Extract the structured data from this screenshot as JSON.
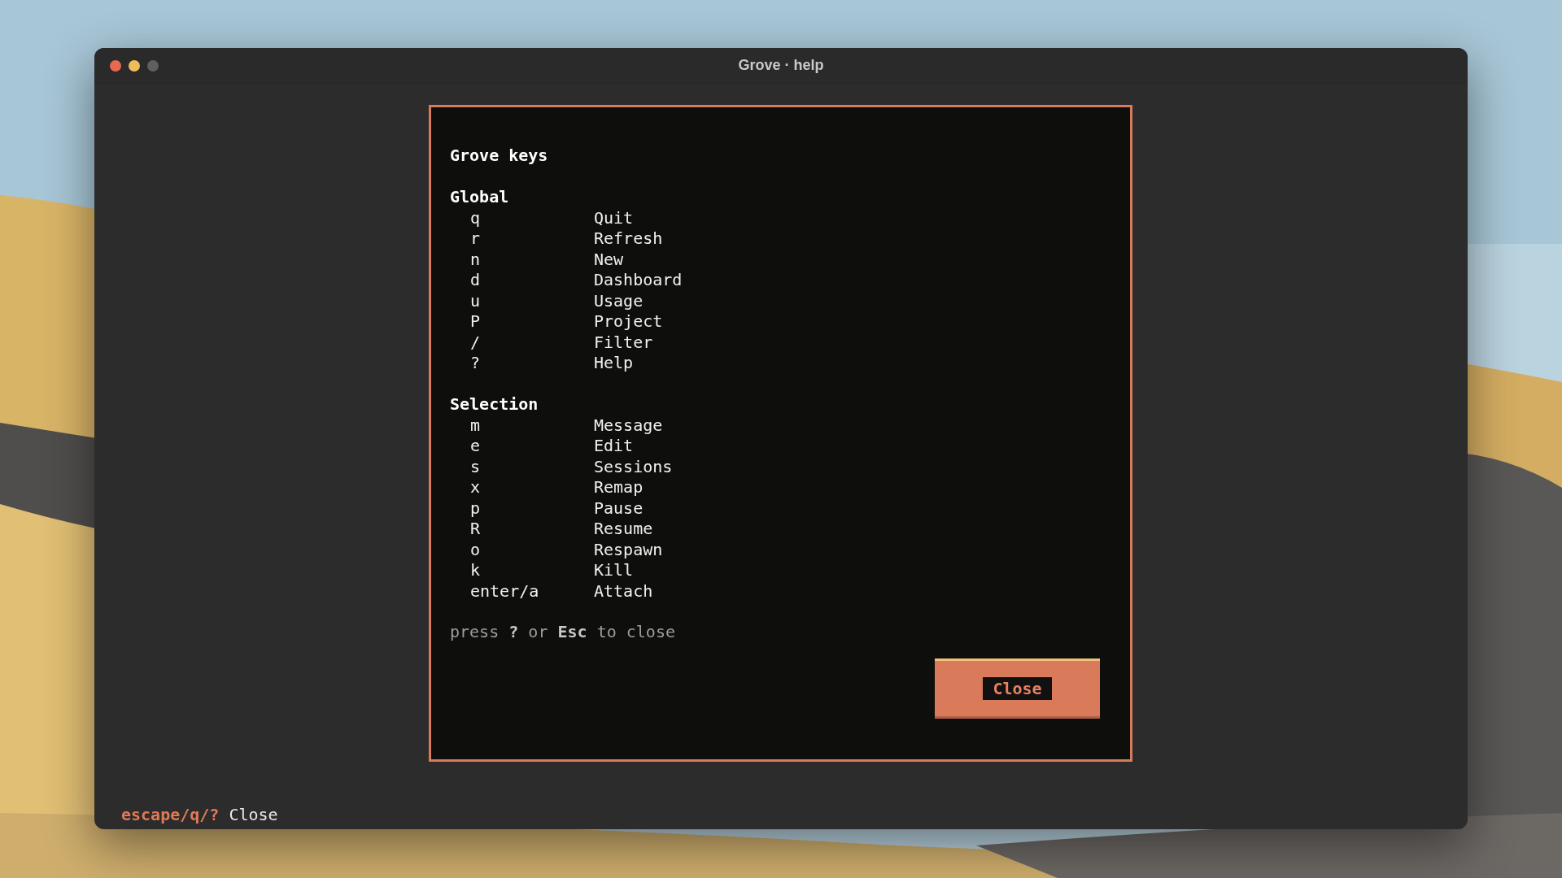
{
  "window": {
    "title": "Grove · help"
  },
  "dialog": {
    "title": "Grove keys",
    "sections": [
      {
        "heading": "Global",
        "bindings": [
          {
            "key": "q",
            "action": "Quit"
          },
          {
            "key": "r",
            "action": "Refresh"
          },
          {
            "key": "n",
            "action": "New"
          },
          {
            "key": "d",
            "action": "Dashboard"
          },
          {
            "key": "u",
            "action": "Usage"
          },
          {
            "key": "P",
            "action": "Project"
          },
          {
            "key": "/",
            "action": "Filter"
          },
          {
            "key": "?",
            "action": "Help"
          }
        ]
      },
      {
        "heading": "Selection",
        "bindings": [
          {
            "key": "m",
            "action": "Message"
          },
          {
            "key": "e",
            "action": "Edit"
          },
          {
            "key": "s",
            "action": "Sessions"
          },
          {
            "key": "x",
            "action": "Remap"
          },
          {
            "key": "p",
            "action": "Pause"
          },
          {
            "key": "R",
            "action": "Resume"
          },
          {
            "key": "o",
            "action": "Respawn"
          },
          {
            "key": "k",
            "action": "Kill"
          },
          {
            "key": "enter/a",
            "action": "Attach"
          }
        ]
      }
    ],
    "hint": "press **?** or **Esc** to close",
    "button": "Close"
  },
  "footer": {
    "key": "escape/q/?",
    "action": "Close"
  }
}
